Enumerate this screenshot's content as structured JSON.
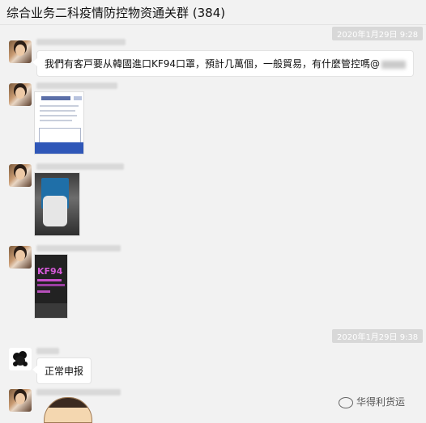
{
  "window": {
    "title": "综合业务二科疫情防控物资通关群 (384)"
  },
  "timestamps": [
    "2020年1月29日 9:28",
    "2020年1月29日 9:38"
  ],
  "messages": [
    {
      "text": "我們有客戸要从韓國進口KF94口罩，預計几萬個，一般貿易，有什麼管控嗎@"
    },
    {
      "image": "document-thumbnail"
    },
    {
      "image": "mask-photo"
    },
    {
      "image": "kf94-box",
      "text": "KF94"
    },
    {
      "text": "正常申报"
    },
    {
      "image": "cartoon-sticker"
    }
  ],
  "footer": {
    "text": "华得利货运"
  }
}
